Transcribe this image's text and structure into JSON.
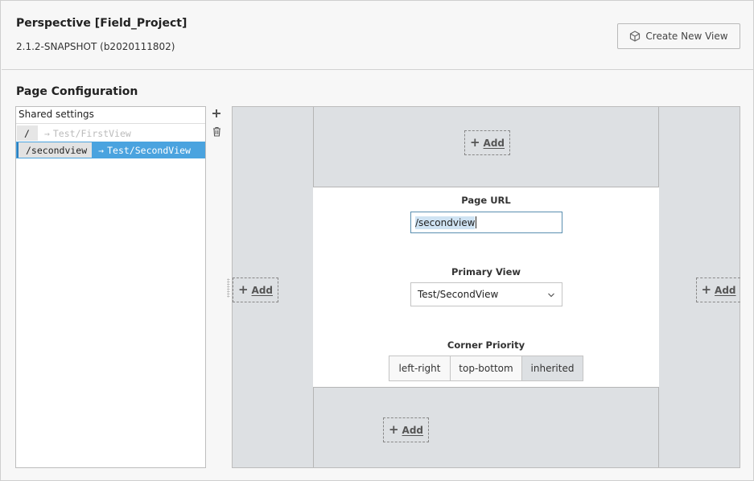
{
  "header": {
    "title": "Perspective [Field_Project]",
    "version": "2.1.2-SNAPSHOT (b2020111802)",
    "create_view_label": "Create New View"
  },
  "page_config": {
    "section_title": "Page Configuration",
    "list_header": "Shared settings",
    "pages": [
      {
        "path": "/",
        "arrow": "→",
        "view": "Test/FirstView"
      },
      {
        "path": "/secondview",
        "arrow": "→",
        "view": "Test/SecondView"
      }
    ]
  },
  "editor": {
    "add_label": "Add",
    "add_plus": "+",
    "page_url_label": "Page URL",
    "page_url_value": "/secondview",
    "primary_view_label": "Primary View",
    "primary_view_value": "Test/SecondView",
    "corner_priority_label": "Corner Priority",
    "corner_options": [
      "left-right",
      "top-bottom",
      "inherited"
    ],
    "corner_selected": "inherited"
  },
  "colors": {
    "selection": "#4aa3df",
    "dock_bg": "#dde0e3",
    "input_focus": "#5a8fb0"
  }
}
